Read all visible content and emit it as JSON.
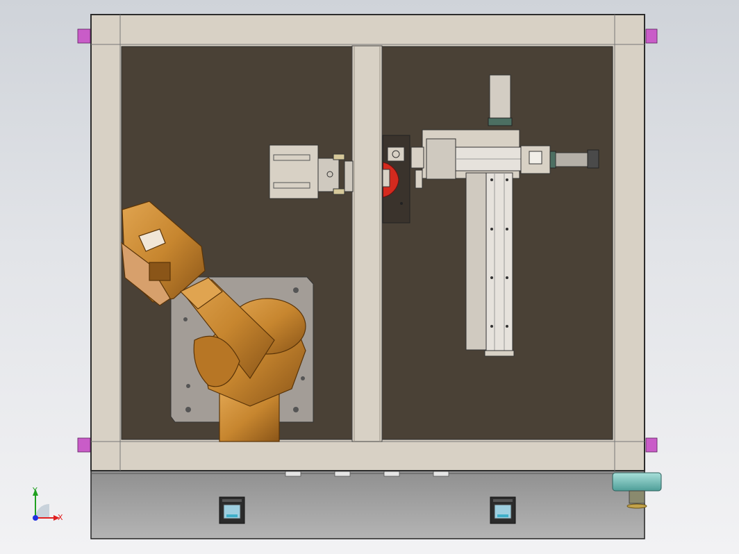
{
  "viewport": {
    "background": "#dfe2e6",
    "triad": {
      "x_label": "X",
      "y_label": "Y"
    }
  },
  "colors": {
    "frame": "#d6cfc4",
    "frame_edge": "#3a3a3a",
    "floor": "#4b4136",
    "robot": "#c7862f",
    "robot_dark": "#8a5518",
    "red_part": "#d42a1e",
    "panel": "#a9a9a9",
    "teal": "#7ec6c0",
    "magenta": "#c95cc8",
    "axis_x": "#e02020",
    "axis_y": "#20a020",
    "axis_z": "#2030e0"
  },
  "icons": {
    "triad": "coordinate-triad-icon"
  }
}
